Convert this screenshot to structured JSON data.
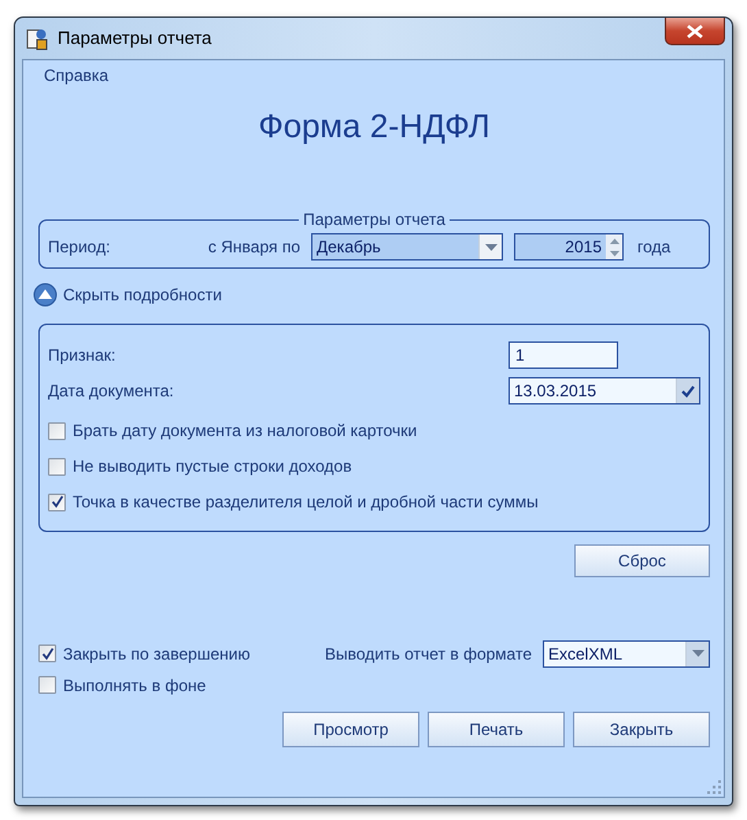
{
  "window": {
    "title": "Параметры отчета"
  },
  "help_link": "Справка",
  "heading": "Форма 2-НДФЛ",
  "period_group": {
    "title": "Параметры отчета",
    "label": "Период:",
    "from_label": "с Января по",
    "month": "Декабрь",
    "year": "2015",
    "year_suffix": "года"
  },
  "details_toggle": {
    "label": "Скрыть подробности",
    "expanded": true
  },
  "details": {
    "fields": [
      {
        "label": "Признак:",
        "value": "1",
        "kind": "text"
      },
      {
        "label": "Дата документа:",
        "value": "13.03.2015",
        "kind": "date"
      }
    ],
    "options": [
      {
        "label": "Брать дату документа из налоговой карточки",
        "checked": false
      },
      {
        "label": "Не выводить пустые строки доходов",
        "checked": false
      },
      {
        "label": "Точка в качестве разделителя целой и дробной части суммы",
        "checked": true
      }
    ]
  },
  "reset_button": "Сброс",
  "bottom_options": [
    {
      "label": "Закрыть по завершению",
      "checked": true
    },
    {
      "label": "Выполнять в фоне",
      "checked": false
    }
  ],
  "format": {
    "label": "Выводить отчет в формате",
    "value": "ExcelXML"
  },
  "buttons": [
    "Просмотр",
    "Печать",
    "Закрыть"
  ]
}
